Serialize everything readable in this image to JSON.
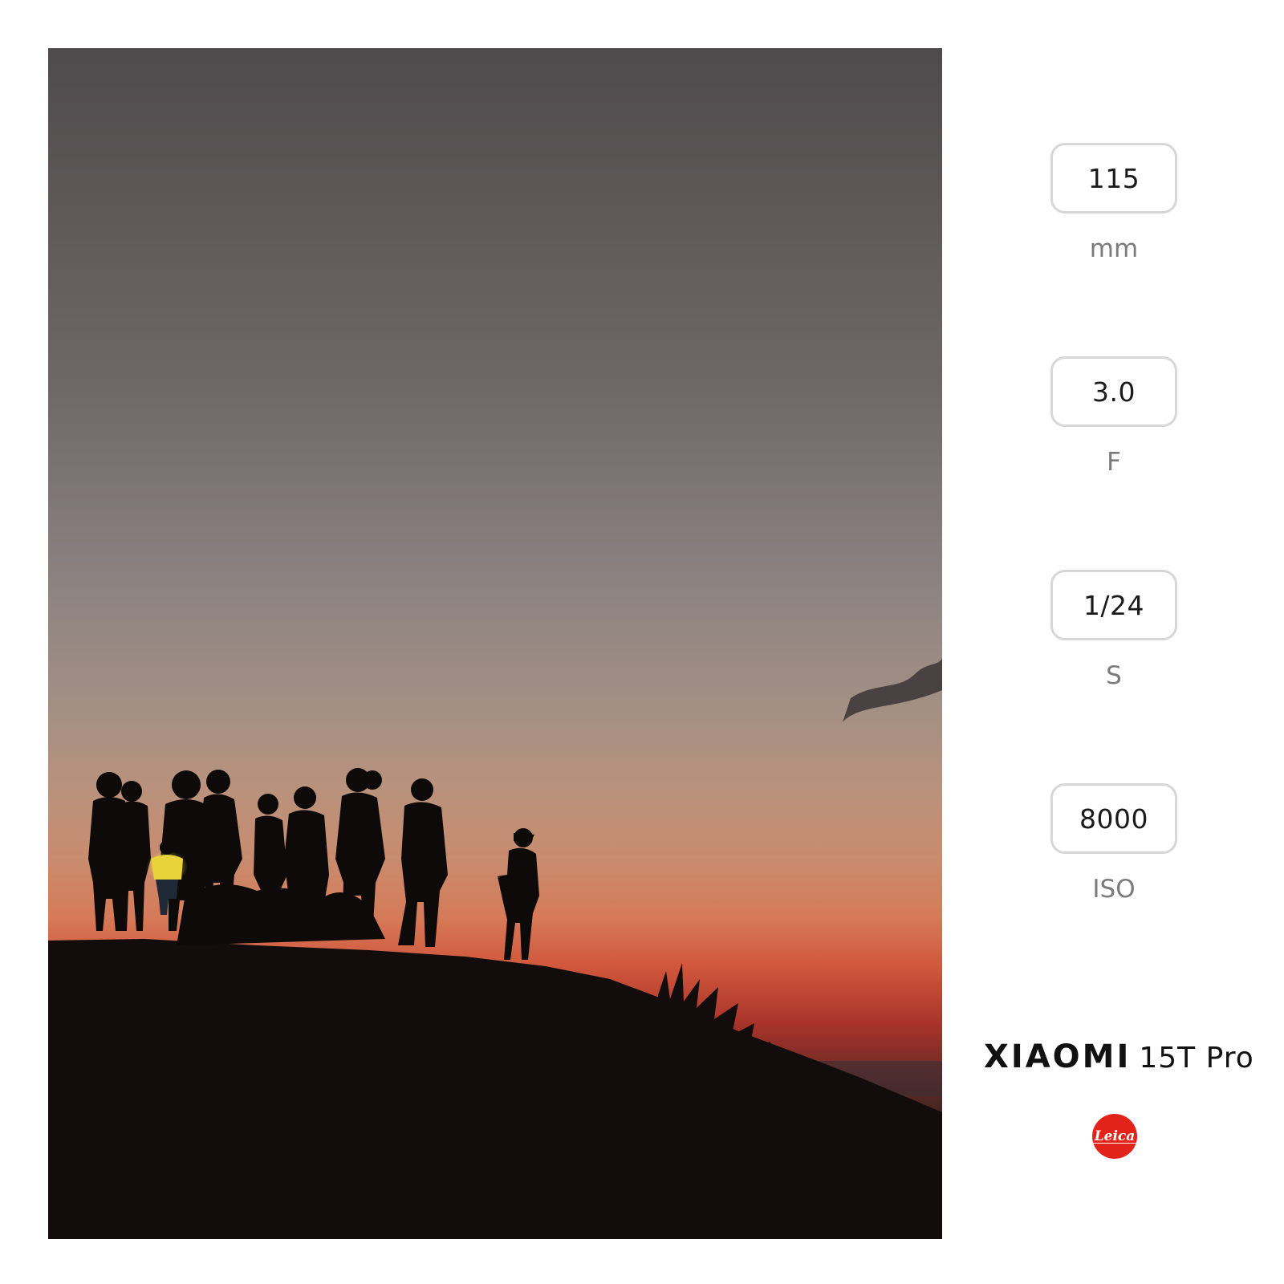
{
  "exif": {
    "focal_length": {
      "value": "115",
      "unit": "mm"
    },
    "aperture": {
      "value": "3.0",
      "unit": "F"
    },
    "shutter": {
      "value": "1/24",
      "unit": "S"
    },
    "iso": {
      "value": "8000",
      "unit": "ISO"
    }
  },
  "brand": {
    "name": "XIAOMI",
    "model": "15T Pro",
    "logo_text": "Leica",
    "logo_color": "#e2231a"
  },
  "photo": {
    "colors": {
      "sky_top": "#4f4a4c",
      "sky_mid": "#8f8684",
      "horizon_peach": "#c8957a",
      "horizon_orange": "#d9704e",
      "horizon_red": "#9a2a20",
      "ground": "#120d0c",
      "phone_glow": "#f3e23a"
    }
  }
}
